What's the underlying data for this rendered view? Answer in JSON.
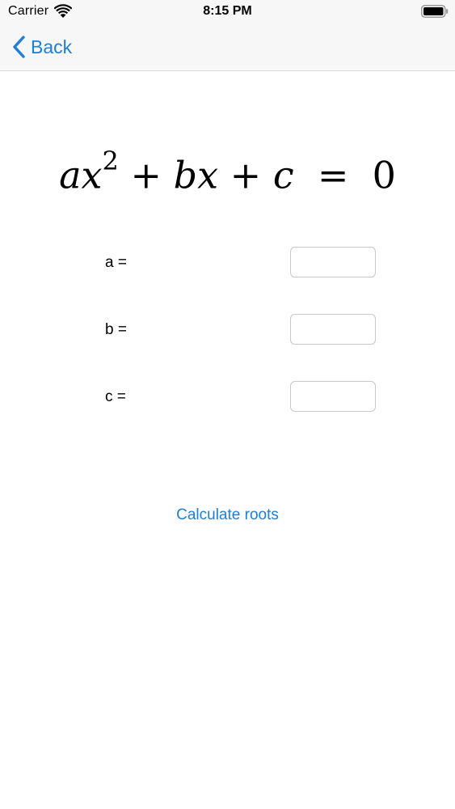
{
  "status_bar": {
    "carrier": "Carrier",
    "time": "8:15 PM",
    "wifi_icon": "wifi-icon",
    "battery_icon": "battery-icon"
  },
  "nav": {
    "back_label": "Back",
    "back_icon": "chevron-left-icon"
  },
  "equation": {
    "a": "a",
    "x1": "x",
    "exp": "2",
    "plus1": "+",
    "b": "b",
    "x2": "x",
    "plus2": "+",
    "c": "c",
    "equals": "=",
    "rhs": "0"
  },
  "coefficients": [
    {
      "label": "a =",
      "value": "",
      "placeholder": ""
    },
    {
      "label": "b =",
      "value": "",
      "placeholder": ""
    },
    {
      "label": "c =",
      "value": "",
      "placeholder": ""
    }
  ],
  "actions": {
    "calculate_label": "Calculate roots"
  },
  "colors": {
    "accent": "#1e7ed8",
    "bar_background": "#f7f7f8"
  }
}
